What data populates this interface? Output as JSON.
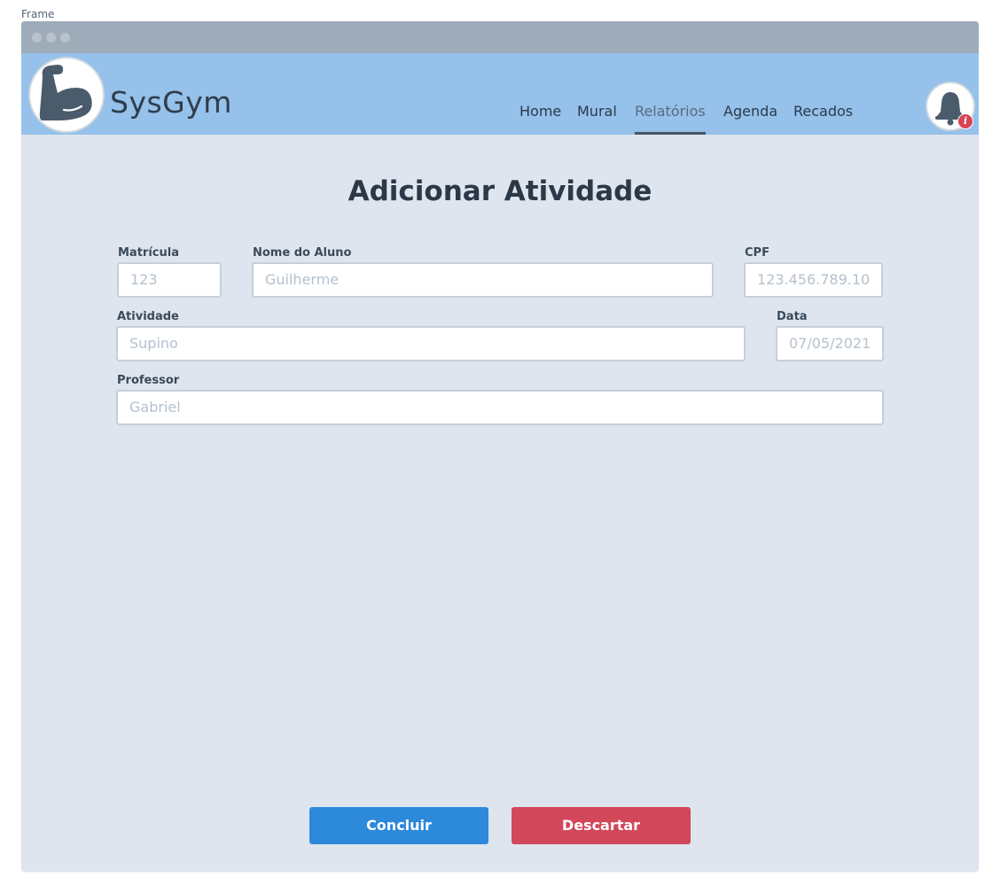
{
  "frame": {
    "label": "Frame"
  },
  "app": {
    "name": "SysGym"
  },
  "nav": {
    "items": [
      {
        "label": "Home"
      },
      {
        "label": "Mural"
      },
      {
        "label": "Relatórios",
        "active": true
      },
      {
        "label": "Agenda"
      },
      {
        "label": "Recados"
      }
    ]
  },
  "notifications": {
    "badge_icon": "info-icon",
    "badge_glyph": "i",
    "badge_color": "#d94354"
  },
  "page": {
    "title": "Adicionar Atividade"
  },
  "form": {
    "matricula": {
      "label": "Matrícula",
      "placeholder": "123"
    },
    "nome": {
      "label": "Nome do Aluno",
      "placeholder": "Guilherme"
    },
    "cpf": {
      "label": "CPF",
      "placeholder": "123.456.789.10"
    },
    "atividade": {
      "label": "Atividade",
      "placeholder": "Supino"
    },
    "data": {
      "label": "Data",
      "placeholder": "07/05/2021"
    },
    "professor": {
      "label": "Professor",
      "placeholder": "Gabriel"
    }
  },
  "actions": {
    "confirm": {
      "label": "Concluir",
      "color": "#2d89da"
    },
    "discard": {
      "label": "Descartar",
      "color": "#d3475b"
    }
  },
  "colors": {
    "header": "#95c1ea",
    "titlebar": "#9eacb9",
    "canvas": "#dfe5ee"
  }
}
